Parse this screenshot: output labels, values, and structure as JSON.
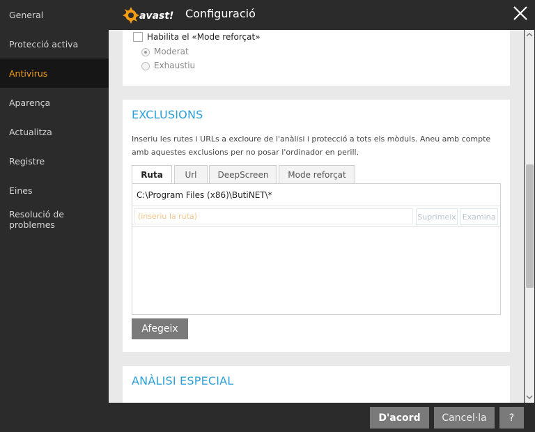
{
  "header": {
    "logo_text": "avast!",
    "title": "Configuració",
    "close_icon": "close-icon"
  },
  "sidebar": {
    "items": [
      {
        "label": "General",
        "active": false
      },
      {
        "label": "Protecció activa",
        "active": false
      },
      {
        "label": "Antivirus",
        "active": true
      },
      {
        "label": "Aparença",
        "active": false
      },
      {
        "label": "Actualitza",
        "active": false
      },
      {
        "label": "Registre",
        "active": false
      },
      {
        "label": "Eines",
        "active": false
      },
      {
        "label": "Resolució de problemes",
        "active": false
      }
    ]
  },
  "hardened_mode": {
    "checkbox_label": "Habilita el «Mode reforçat»",
    "checked": false,
    "options": [
      {
        "label": "Moderat",
        "selected": true
      },
      {
        "label": "Exhaustiu",
        "selected": false
      }
    ]
  },
  "exclusions": {
    "title": "EXCLUSIONS",
    "description": "Inseriu les rutes i URLs a excloure de l'anàlisi i protecció a tots els mòduls. Aneu amb compte amb aquestes exclusions per no posar l'ordinador en perill.",
    "tabs": [
      {
        "label": "Ruta",
        "active": true
      },
      {
        "label": "Url",
        "active": false
      },
      {
        "label": "DeepScreen",
        "active": false
      },
      {
        "label": "Mode reforçat",
        "active": false
      }
    ],
    "paths": [
      "C:\\Program Files (x86)\\ButiNET\\*"
    ],
    "input_placeholder": "(inseriu la ruta)",
    "delete_label": "Suprimeix",
    "browse_label": "Examina",
    "add_label": "Afegeix"
  },
  "special_scans": {
    "title": "ANÀLISI ESPECIAL"
  },
  "footer": {
    "ok_label": "D'acord",
    "cancel_label": "Cancel·la",
    "help_label": "?"
  },
  "colors": {
    "accent_orange": "#f39c12",
    "section_blue": "#2a9fd6",
    "dark_bg": "#2b2b2b",
    "button_gray": "#7a7a7a"
  }
}
